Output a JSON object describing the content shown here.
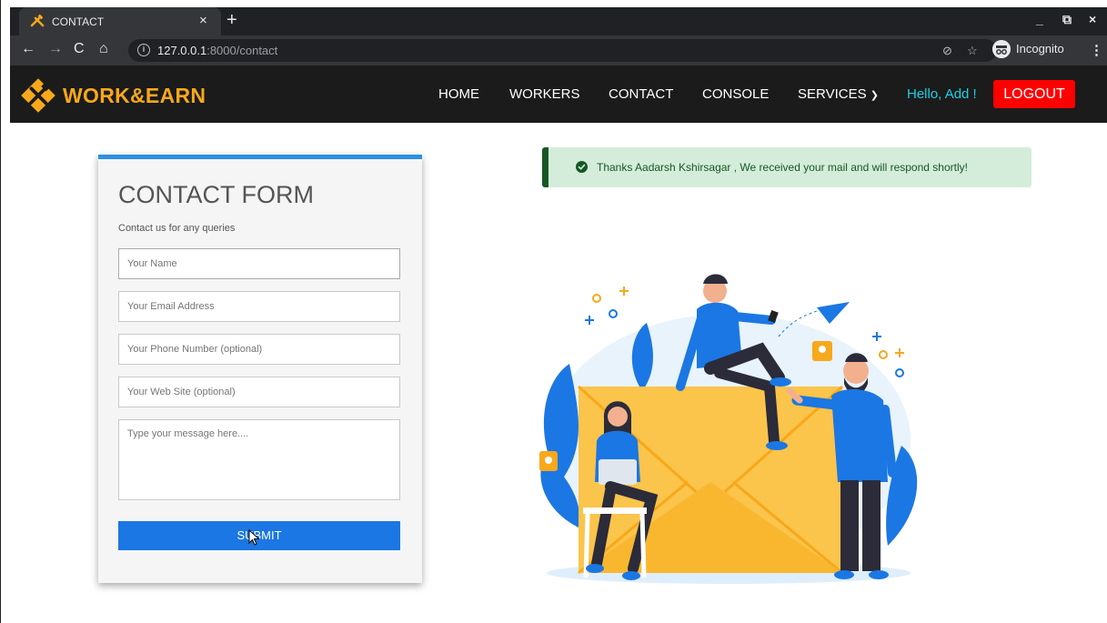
{
  "browser": {
    "tab_title": "CONTACT",
    "tab_close": "×",
    "new_tab": "+",
    "minimize": "_",
    "restore": "⧉",
    "close": "×",
    "url_host": "127.0.0.1",
    "url_path": ":8000/contact",
    "incognito_label": "Incognito"
  },
  "navbar": {
    "brand": "WORK&EARN",
    "links": [
      "HOME",
      "WORKERS",
      "CONTACT",
      "CONSOLE",
      "SERVICES"
    ],
    "greeting": "Hello, Add !",
    "logout": "LOGOUT"
  },
  "form": {
    "title": "CONTACT FORM",
    "subtitle": "Contact us for any queries",
    "name_placeholder": "Your Name",
    "email_placeholder": "Your Email Address",
    "phone_placeholder": "Your Phone Number (optional)",
    "website_placeholder": "Your Web Site (optional)",
    "message_placeholder": "Type your message here....",
    "submit_label": "SUBMIT"
  },
  "alert": {
    "message": "Thanks Aadarsh Kshirsagar , We received your mail and will respond shortly!"
  },
  "colors": {
    "brand": "#f7a81b",
    "navbar_bg": "#1b1b1b",
    "accent": "#1b77e3",
    "logout": "#ff0000",
    "greeting": "#19d2e6",
    "alert_bg": "#d4edda",
    "alert_text": "#155724"
  }
}
